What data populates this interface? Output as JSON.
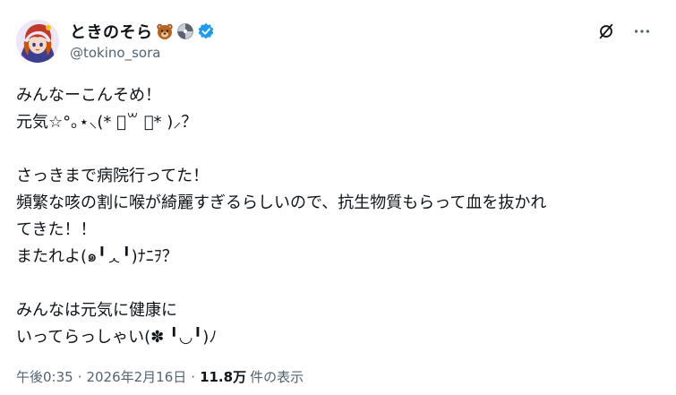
{
  "author": {
    "display_name": "ときのそら",
    "handle": "@tokino_sora",
    "verified": true,
    "badge_emojis": [
      "bear-face-icon",
      "sphere-badge-icon"
    ]
  },
  "tweet": {
    "text": "みんなーこんそめ！\n元気☆°｡⋆⸜(* ॑꒳ ॑* )⸝？\n\nさっきまで病院行ってた！\n頻繁な咳の割に喉が綺麗すぎるらしいので、抗生物質もらって血を抜かれ\nてきた！！\nまたれよ(๑╹ᆺ╹)ﾅﾆｦ？\n\nみんなは元気に健康に\nいってらっしゃい(✽ ╹◡╹)ﾉ"
  },
  "meta": {
    "time": "午後0:35",
    "date": "2026年2月16日",
    "views_count": "11.8万",
    "views_label": "件の表示",
    "separator": "·"
  },
  "colors": {
    "verified": "#1d9bf0",
    "text_primary": "#0f1419",
    "text_secondary": "#536471"
  }
}
